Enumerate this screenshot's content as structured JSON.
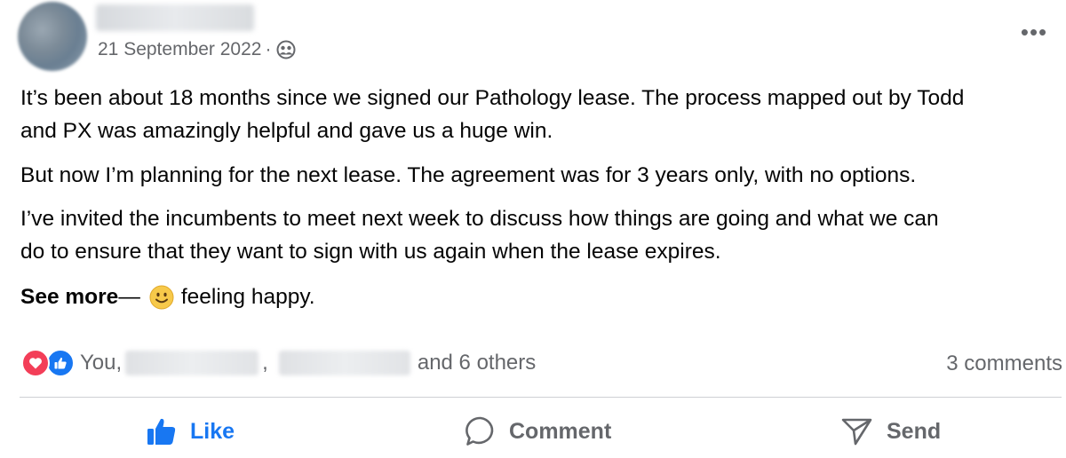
{
  "post": {
    "timestamp": "21 September 2022",
    "separator": "·",
    "audience_icon": "friends-icon",
    "more_label": "•••",
    "paragraphs": {
      "p1_line1": "It’s been about 18 months since we signed our Pathology lease. The process mapped out by Todd",
      "p1_line2": "and PX was amazingly helpful and gave us a huge win.",
      "p2": "But now I’m planning for the next lease. The agreement was for 3 years only, with no options.",
      "p3_line1": "I’ve invited the incumbents to meet next week to discuss how things are going and what we can",
      "p3_line2": "do to ensure that they want to sign with us again when the lease expires."
    },
    "see_more": "See more",
    "feeling_dash": "—",
    "feeling_text": "feeling happy."
  },
  "reactions": {
    "icons": [
      "love-icon",
      "like-icon"
    ],
    "you": "You,",
    "comma": ",",
    "others": "and 6 others",
    "comments": "3 comments"
  },
  "actions": {
    "like": "Like",
    "comment": "Comment",
    "send": "Send"
  },
  "colors": {
    "like_blue": "#1877f2",
    "love_red": "#f33e58",
    "secondary_text": "#65676b",
    "divider": "#ced0d4"
  }
}
